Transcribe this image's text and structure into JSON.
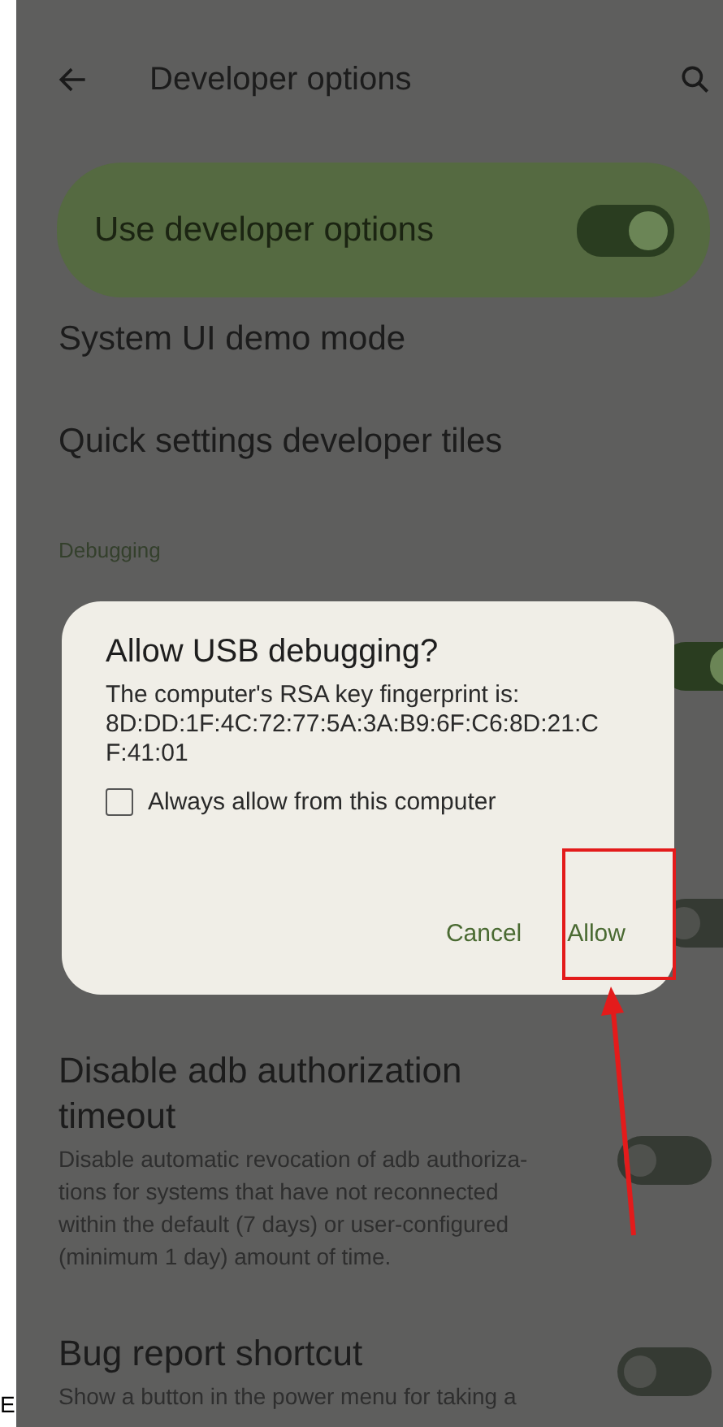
{
  "edge_text": "E",
  "header": {
    "title": "Developer options"
  },
  "main_switch": {
    "label": "Use developer options",
    "on": true
  },
  "items": [
    {
      "title": "System UI demo mode"
    },
    {
      "title": "Quick settings developer tiles"
    }
  ],
  "section": "Debugging",
  "covered_switches": [
    {
      "on": true
    },
    {
      "on": false
    }
  ],
  "dialog": {
    "title": "Allow USB debugging?",
    "message": "The computer's RSA key fingerprint is:",
    "fingerprint_lines": [
      "8D:DD:1F:4C:72:77:5A:3A:B9:6F:C6:8D:21:C",
      "F:41:01"
    ],
    "checkbox": {
      "label": "Always allow from this computer",
      "checked": false
    },
    "buttons": [
      "Cancel",
      "Allow"
    ]
  },
  "settings": [
    {
      "title": "Disable adb authorization timeout",
      "description_lines": [
        "Disable automatic revocation of adb authoriza-",
        "tions for systems that have not reconnected",
        "within the default (7 days) or user-configured",
        "(minimum 1 day) amount of time."
      ],
      "on": false
    },
    {
      "title": "Bug report shortcut",
      "description_lines": [
        "Show a button in the power menu for taking a"
      ],
      "on": false
    }
  ]
}
